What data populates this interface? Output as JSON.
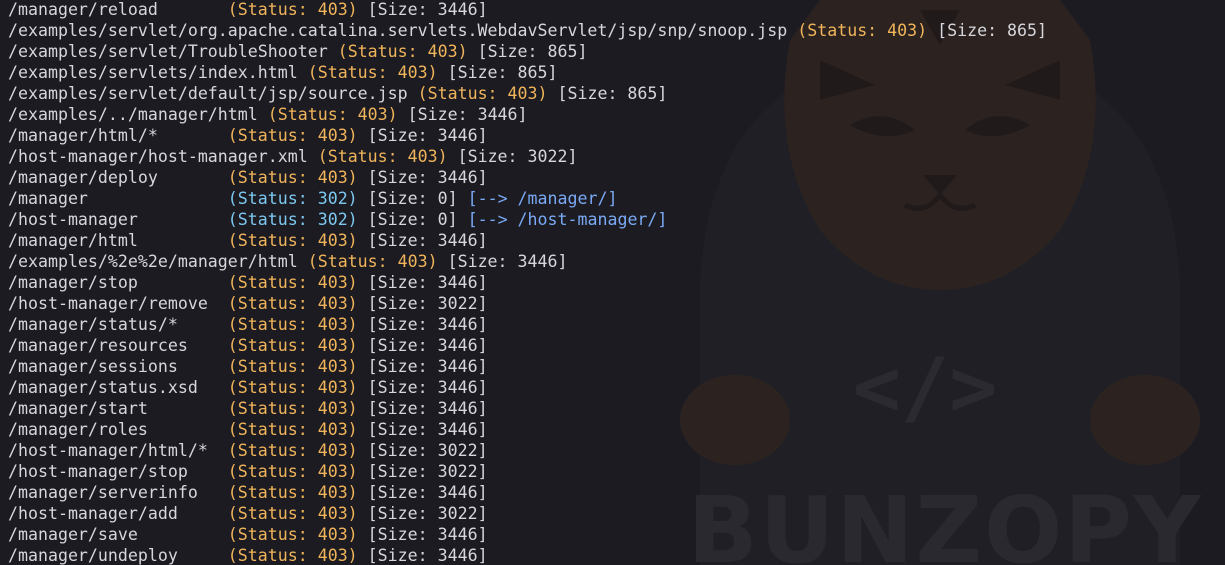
{
  "colors": {
    "background": "#1c1b22",
    "text": "#d6d6dc",
    "status_403": "#f0b45a",
    "status_302": "#7cc8f0",
    "redirect": "#7aaaf5"
  },
  "watermark": {
    "text": "BUNZOPY",
    "icon": "tiger-mascot-icon",
    "code_symbol": "</>"
  },
  "lines": [
    {
      "path": "/manager/reload      ",
      "status": "(Status: 403)",
      "size": "[Size: 3446]"
    },
    {
      "path": "/examples/servlet/org.apache.catalina.servlets.WebdavServlet/jsp/snp/snoop.jsp",
      "status": "(Status: 403)",
      "size": "[Size: 865]"
    },
    {
      "path": "/examples/servlet/TroubleShooter",
      "status": "(Status: 403)",
      "size": "[Size: 865]"
    },
    {
      "path": "/examples/servlets/index.html",
      "status": "(Status: 403)",
      "size": "[Size: 865]"
    },
    {
      "path": "/examples/servlet/default/jsp/source.jsp",
      "status": "(Status: 403)",
      "size": "[Size: 865]"
    },
    {
      "path": "/examples/../manager/html",
      "status": "(Status: 403)",
      "size": "[Size: 3446]"
    },
    {
      "path": "/manager/html/*      ",
      "status": "(Status: 403)",
      "size": "[Size: 3446]"
    },
    {
      "path": "/host-manager/host-manager.xml",
      "status": "(Status: 403)",
      "size": "[Size: 3022]"
    },
    {
      "path": "/manager/deploy      ",
      "status": "(Status: 403)",
      "size": "[Size: 3446]"
    },
    {
      "path": "/manager             ",
      "status": "(Status: 302)",
      "size": "[Size: 0]",
      "redirect": "[--> /manager/]"
    },
    {
      "path": "/host-manager        ",
      "status": "(Status: 302)",
      "size": "[Size: 0]",
      "redirect": "[--> /host-manager/]"
    },
    {
      "path": "/manager/html        ",
      "status": "(Status: 403)",
      "size": "[Size: 3446]"
    },
    {
      "path": "/examples/%2e%2e/manager/html",
      "status": "(Status: 403)",
      "size": "[Size: 3446]"
    },
    {
      "path": "/manager/stop        ",
      "status": "(Status: 403)",
      "size": "[Size: 3446]"
    },
    {
      "path": "/host-manager/remove ",
      "status": "(Status: 403)",
      "size": "[Size: 3022]"
    },
    {
      "path": "/manager/status/*    ",
      "status": "(Status: 403)",
      "size": "[Size: 3446]"
    },
    {
      "path": "/manager/resources   ",
      "status": "(Status: 403)",
      "size": "[Size: 3446]"
    },
    {
      "path": "/manager/sessions    ",
      "status": "(Status: 403)",
      "size": "[Size: 3446]"
    },
    {
      "path": "/manager/status.xsd  ",
      "status": "(Status: 403)",
      "size": "[Size: 3446]"
    },
    {
      "path": "/manager/start       ",
      "status": "(Status: 403)",
      "size": "[Size: 3446]"
    },
    {
      "path": "/manager/roles       ",
      "status": "(Status: 403)",
      "size": "[Size: 3446]"
    },
    {
      "path": "/host-manager/html/* ",
      "status": "(Status: 403)",
      "size": "[Size: 3022]"
    },
    {
      "path": "/host-manager/stop   ",
      "status": "(Status: 403)",
      "size": "[Size: 3022]"
    },
    {
      "path": "/manager/serverinfo  ",
      "status": "(Status: 403)",
      "size": "[Size: 3446]"
    },
    {
      "path": "/host-manager/add    ",
      "status": "(Status: 403)",
      "size": "[Size: 3022]"
    },
    {
      "path": "/manager/save        ",
      "status": "(Status: 403)",
      "size": "[Size: 3446]"
    },
    {
      "path": "/manager/undeploy    ",
      "status": "(Status: 403)",
      "size": "[Size: 3446]"
    }
  ]
}
